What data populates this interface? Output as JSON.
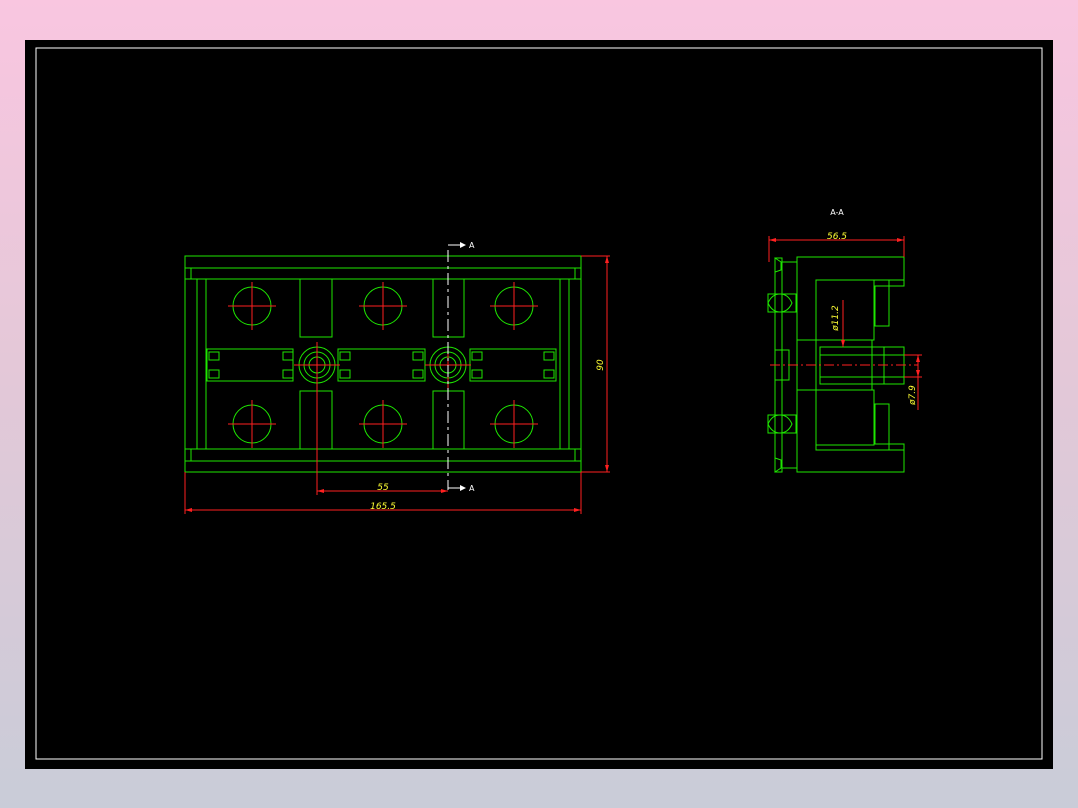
{
  "drawing": {
    "colors": {
      "background": "#000000",
      "geometry": "#1ee600",
      "centerlines": "#ff2020",
      "dimension_text": "#ffff33",
      "frame": "#ffffff"
    },
    "front_view": {
      "section_marker_top": "A",
      "section_marker_bottom": "A",
      "dim_height": "90",
      "dim_pitch": "55",
      "dim_width": "165.5"
    },
    "section_view": {
      "title": "A-A",
      "dim_width": "56.5",
      "dim_bore_large": "ø11.2",
      "dim_bore_small": "ø7.9"
    }
  }
}
